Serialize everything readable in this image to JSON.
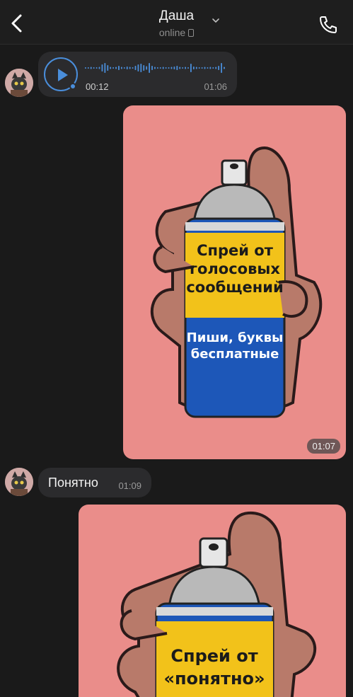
{
  "header": {
    "title": "Даша",
    "status": "online"
  },
  "messages": {
    "voice": {
      "current_time": "00:12",
      "sent_time": "01:06",
      "progress": 0.0
    },
    "image1": {
      "sent_time": "01:07",
      "line1": "Спрей от",
      "line2": "голосовых",
      "line3": "сообщений",
      "line4": "Пиши, буквы",
      "line5": "бесплатные"
    },
    "text1": {
      "text": "Понятно",
      "sent_time": "01:09"
    },
    "image2": {
      "line1": "Спрей от",
      "line2": "«понятно»"
    }
  },
  "colors": {
    "accent": "#4a8edb",
    "bubble": "#2b2b2d",
    "image_bg": "#ea8d8a",
    "can_blue": "#1d57b8",
    "can_yellow": "#f2c21a"
  }
}
